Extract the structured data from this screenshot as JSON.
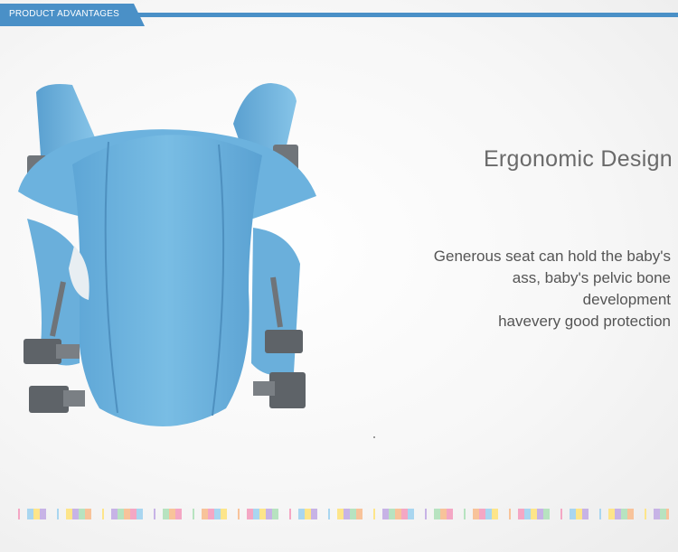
{
  "header": {
    "label": "PRODUCT ADVANTAGES",
    "accent_color": "#4a90c7"
  },
  "product_image": {
    "subject": "baby-carrier",
    "main_color": "#6fb3dc",
    "strap_color": "#707478"
  },
  "feature": {
    "title": "Ergonomic Design",
    "lines": [
      "Generous seat can hold the baby's",
      "ass, baby's pelvic bone",
      "development",
      "havevery good protection"
    ]
  },
  "decor": {
    "stripe_colors": [
      "#f4a7c4",
      "#a9d6f0",
      "#fde58a",
      "#c7b3e6",
      "#b7e3c0",
      "#f8c39a"
    ]
  }
}
